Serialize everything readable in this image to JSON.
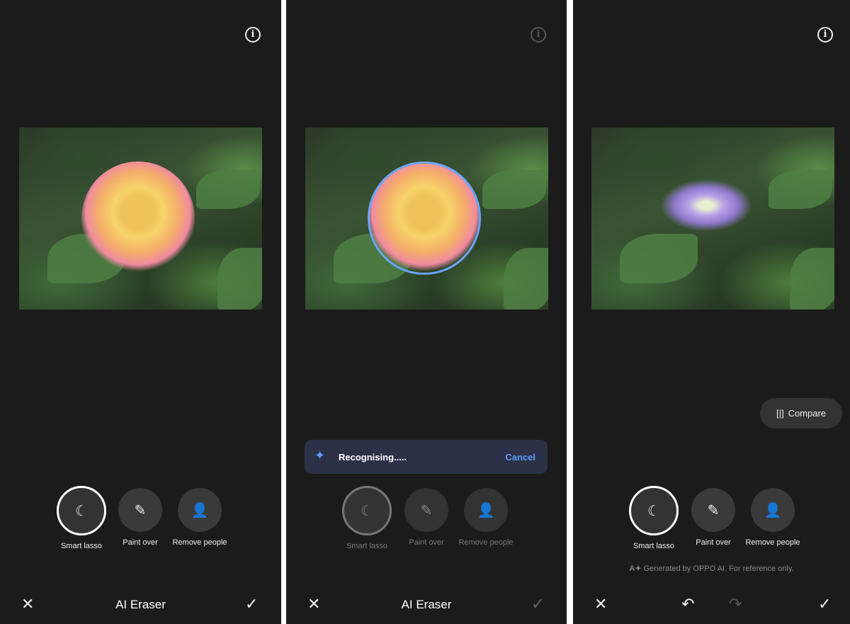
{
  "title": "AI Eraser",
  "tools": [
    "Smart lasso",
    "Paint over",
    "Remove people"
  ],
  "toast": {
    "message": "Recognising.....",
    "cancel": "Cancel"
  },
  "compare": "Compare",
  "disclaimer": "Generated by OPPO AI. For reference only.",
  "icons": {
    "info": "i",
    "close": "✕",
    "confirm": "✓",
    "undo": "↶",
    "redo": "↷",
    "sparkle": "✦"
  },
  "colors": {
    "accent": "#5b9bff",
    "background": "#1b1b1b",
    "toast": "#2d3148"
  }
}
